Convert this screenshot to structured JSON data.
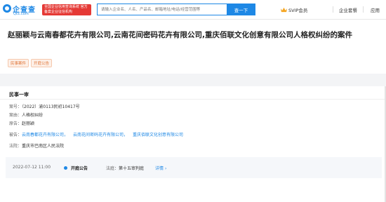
{
  "header": {
    "logo_text": "企查查",
    "logo_domain": "Qcc.com",
    "slogan": "全国企业信用查询系统 官方备案企业征信机构",
    "search_placeholder": "请输入企业名、人名、产品名、邮箱地址/电话/经营范围等",
    "search_button": "查一下",
    "svip": "SVIP会员",
    "enterprise": "企业套餐",
    "app": "应用"
  },
  "case": {
    "title": "赵丽颖与云南春都花卉有限公司,云南花间密码花卉有限公司,重庆佰联文化创意有限公司人格权纠纷的案件",
    "tags": [
      "民事案件",
      "开庭公告"
    ]
  },
  "detail": {
    "section": "民事一审",
    "case_no_label": "案号：",
    "case_no": "（2022）渝0113民初10417号",
    "cause_label": "案由：",
    "cause": "人格权纠纷",
    "plaintiff_label": "原告：",
    "plaintiff": "赵丽颖",
    "defendant_label": "被告：",
    "defendants": [
      "云南春都花卉有限公司，",
      "云南花间密码花卉有限公司，",
      "重庆佰联文化创意有限公司"
    ],
    "court_label": "法院：",
    "court": "重庆市巴南区人民法院"
  },
  "timeline": {
    "datetime": "2022-07-12 11:00",
    "event": "开庭公告",
    "court_label": "法庭：",
    "courtroom": "第十五审判庭",
    "detail_link": "详情"
  },
  "colors": {
    "brand": "#1e88e5",
    "tag_text": "#e0763a",
    "slogan_bg": "#e53935"
  }
}
